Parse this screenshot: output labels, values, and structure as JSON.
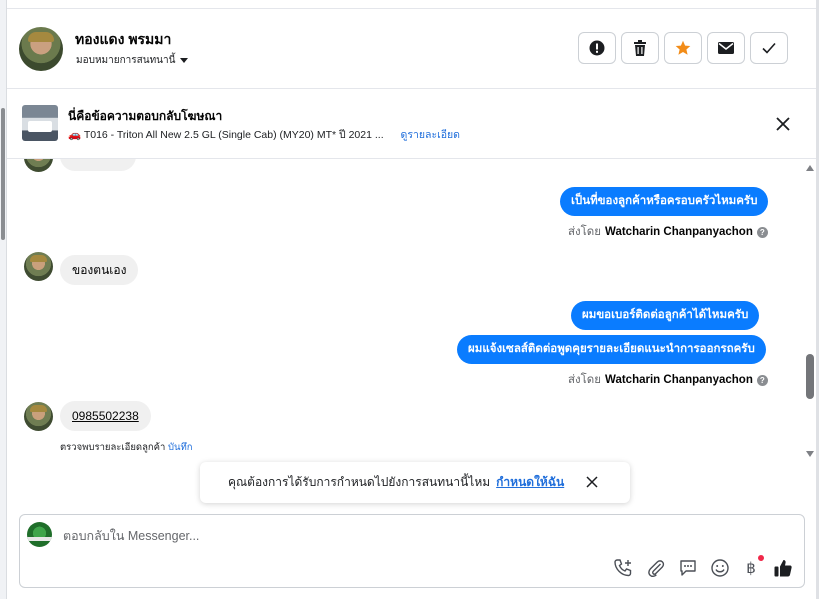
{
  "header": {
    "contact_name": "ทองแดง พรมมา",
    "assign_label": "มอบหมายการสนทนานี้"
  },
  "ad_banner": {
    "title": "นี่คือข้อความตอบกลับโฆษณา",
    "product_icon": "car-icon",
    "product": "T016 - Triton All New 2.5 GL (Single Cab) (MY20) MT* ปี 2021 ...",
    "details_link": "ดูรายละเอียด"
  },
  "messages": {
    "out_1": "เป็นที่ของลูกค้าหรือครอบครัวไหมครับ",
    "sent_by_1_prefix": "ส่งโดย",
    "sent_by_1_name": "Watcharin Chanpanyachon",
    "in_1": "ของตนเอง",
    "out_2": "ผมขอเบอร์ติดต่อลูกค้าได้ไหมครับ",
    "out_3": "ผมแจ้งเซลส์ติดต่อพูดคุยรายละเอียดแนะนำการออกรถครับ",
    "sent_by_2_prefix": "ส่งโดย",
    "sent_by_2_name": "Watcharin Chanpanyachon",
    "in_2": "0985502238",
    "note_text": "ตรวจพบรายละเอียดลูกค้า",
    "note_link": "บันทึก"
  },
  "toast": {
    "text": "คุณต้องการได้รับการกำหนดไปยังการสนทนานี้ไหม",
    "link": "กำหนดให้ฉัน"
  },
  "composer": {
    "placeholder": "ตอบกลับใน Messenger...",
    "tools": [
      "add-call-icon",
      "paperclip-icon",
      "saved-reply-icon",
      "emoji-icon",
      "baht-payment-icon",
      "thumbs-up-icon"
    ],
    "baht_symbol": "฿"
  },
  "colors": {
    "accent": "#0a7cff",
    "star": "#f28c18",
    "link": "#216fdb"
  }
}
